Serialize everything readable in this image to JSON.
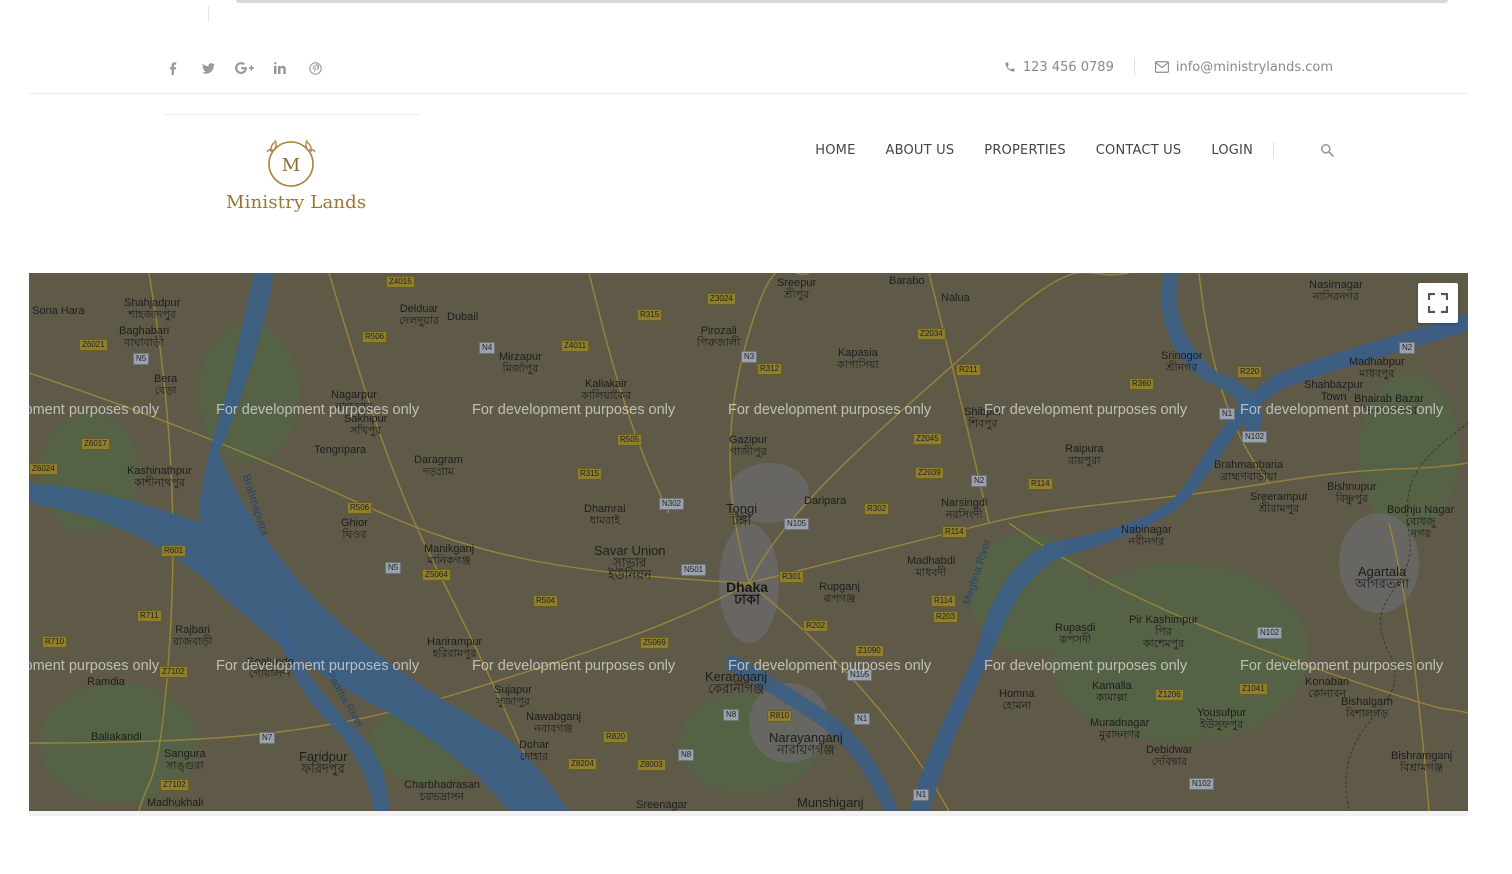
{
  "topbar": {
    "social": [
      {
        "icon": "facebook-icon",
        "glyph": "f"
      },
      {
        "icon": "twitter-icon",
        "glyph": "t"
      },
      {
        "icon": "google-plus-icon",
        "glyph": "G+"
      },
      {
        "icon": "linkedin-icon",
        "glyph": "in"
      },
      {
        "icon": "pinterest-icon",
        "glyph": "p"
      }
    ],
    "phone": "123 456 0789",
    "email": "info@ministrylands.com"
  },
  "header": {
    "logo_monogram": "M",
    "logo_text": "Ministry Lands",
    "nav": {
      "home": "HOME",
      "about": "ABOUT US",
      "properties": "PROPERTIES",
      "contact": "CONTACT US",
      "login": "LOGIN"
    }
  },
  "map": {
    "watermark": "For development purposes only",
    "labels": [
      {
        "t": "Sona Hara"
      },
      {
        "t": "Shahjadpur\nশাহজাদপুর"
      },
      {
        "t": "Baghabari\nবাঘাবাড়ী"
      },
      {
        "t": "Bera\nবেড়া"
      },
      {
        "t": "Delduar\nদেলদুয়ার"
      },
      {
        "t": "Dubail"
      },
      {
        "t": "Mirzapur\nমির্জাপুর"
      },
      {
        "t": "Nagarpur\nনাগরপুর"
      },
      {
        "t": "Kaliakair\nকালিয়াকৈর"
      },
      {
        "t": "Pirozali\nপিরুজালী"
      },
      {
        "t": "Sreepur\nশ্রীপুর"
      },
      {
        "t": "Barabo"
      },
      {
        "t": "Nalua"
      },
      {
        "t": "Kapasia\nকাপাসিয়া"
      },
      {
        "t": "Srinogor\nশ্রীনগর"
      },
      {
        "t": "Nasirnagar\nনাসিরনগর"
      },
      {
        "t": "Madhabpur\nমাধবপুর"
      },
      {
        "t": "Shahbazpur\nTown"
      },
      {
        "t": "Bhairab Bazar\nভৈরব বাজার"
      },
      {
        "t": "Tengripara"
      },
      {
        "t": "Daragram\nদড়গ্রাম"
      },
      {
        "t": "Gazipur\nগাজীপুর"
      },
      {
        "t": "Raipura\nরায়পুরা"
      },
      {
        "t": "Brahmanbaria\nব্রাহ্মণবাড়ীয়া"
      },
      {
        "t": "Kashinathpur\nকাশীনাথপুর"
      },
      {
        "t": "Dhamrai\nধামরাই"
      },
      {
        "t": "Tongi\nটঙ্গী"
      },
      {
        "t": "Daripara"
      },
      {
        "t": "Narsingdi\nনরসিংদী"
      },
      {
        "t": "Sreerampur\nশ্রীরামপুর"
      },
      {
        "t": "Bishnupur\nবিষ্ণুপুর"
      },
      {
        "t": "Bodhju Nagar\nবোধজু\nনগর"
      },
      {
        "t": "Ghior\nঘিওর"
      },
      {
        "t": "Manikganj\nমানিকগঞ্জ"
      },
      {
        "t": "Savar Union\nসাভার\nইউনিয়ন"
      },
      {
        "t": "Nabinagar\nনবীনগর"
      },
      {
        "t": "Madhabdi\nমাধবদী"
      },
      {
        "t": "Dhaka\nঢাকা"
      },
      {
        "t": "Rupganj\nরূপগঞ্জ"
      },
      {
        "t": "Agartala\nআগরতলা"
      },
      {
        "t": "Rajbari\nরাজবাড়ী"
      },
      {
        "t": "Harirampur\nহরিরামপুর"
      },
      {
        "t": "Rupasdi\nরূপসদী"
      },
      {
        "t": "Pir Kashimpur\nপির\nকাশেমপুর"
      },
      {
        "t": "Ramdia"
      },
      {
        "t": "Goalundo\nগোয়ালন্দ"
      },
      {
        "t": "Keraniganj\nকেরানীগঞ্জ"
      },
      {
        "t": "Homna\nহোমনা"
      },
      {
        "t": "Kamalla\nকামাল্লা"
      },
      {
        "t": "Konaban\nকোনাবন"
      },
      {
        "t": "Sujapur\nসুজাপুর"
      },
      {
        "t": "Nawabganj\nনবাবগঞ্জ"
      },
      {
        "t": "Yousufpur\nইউসুফপুর"
      },
      {
        "t": "Bishalgarh\nবিশালগড়"
      },
      {
        "t": "Baliakandi"
      },
      {
        "t": "Dohar\nদোহার"
      },
      {
        "t": "Narayanganj\nনারায়ণগঞ্জ"
      },
      {
        "t": "Muradnagar\nমুরাদনগর"
      },
      {
        "t": "Sangura\nসাঙ্গুরা"
      },
      {
        "t": "Faridpur\nফরিদপুর"
      },
      {
        "t": "Debidwar\nদেবিদ্বার"
      },
      {
        "t": "Bishramganj\nবিশ্রামগঞ্জ"
      },
      {
        "t": "Madhukhali"
      },
      {
        "t": "Charbhadrasan\nচরভদ্রাসন"
      },
      {
        "t": "Sreenagar"
      },
      {
        "t": "Munshiganj"
      },
      {
        "t": "Brahmaputra"
      },
      {
        "t": "Padma River"
      },
      {
        "t": "Meghna River"
      },
      {
        "t": "Shibpur\nশিবপুর"
      },
      {
        "t": "Sakhipur\nসখিপুর"
      }
    ],
    "road_labels": [
      "Z4015",
      "R506",
      "Z6021",
      "N5",
      "Z6017",
      "Z6024",
      "R601",
      "R711",
      "R710",
      "Z7102",
      "R506",
      "N5",
      "R315",
      "Z3024",
      "Z4011",
      "N4",
      "N3",
      "R312",
      "Z2034",
      "R211",
      "R360",
      "Z2045",
      "Z2039",
      "N2",
      "R114",
      "N102",
      "N302",
      "R505",
      "R315",
      "N105",
      "R302",
      "R114",
      "N501",
      "R301",
      "Z5064",
      "R504",
      "Z5069",
      "R202",
      "R114",
      "R203",
      "Z1090",
      "N105",
      "N1",
      "N102",
      "Z1206",
      "Z1041",
      "R810",
      "N8",
      "R820",
      "Z8204",
      "Z8003",
      "N8",
      "N7",
      "Z7102",
      "N1",
      "N102",
      "N2",
      "R220",
      "N1"
    ]
  }
}
